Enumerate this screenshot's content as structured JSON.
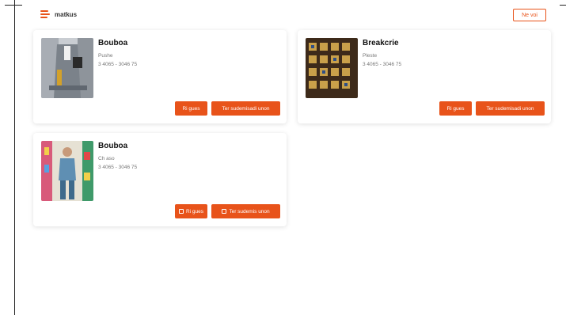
{
  "header": {
    "brand": "matkus",
    "top_button": "Ne voi"
  },
  "cards": [
    {
      "title": "Bouboa",
      "meta_1": "Pushe",
      "meta_2": "3 4065 - 3046 75",
      "primary_label": "Ri gues",
      "secondary_label": "Ter sudemisadi unon"
    },
    {
      "title": "Breakcrie",
      "meta_1": "Pleste",
      "meta_2": "3 4065 - 3046 75",
      "primary_label": "Ri gues",
      "secondary_label": "Ter sudemisadi unon"
    },
    {
      "title": "Bouboa",
      "meta_1": "Ch aso",
      "meta_2": "3 4065 - 3046 75",
      "primary_label": "Ri gues",
      "secondary_label": "Ter sudemis unon"
    }
  ],
  "colors": {
    "accent": "#e8531a"
  }
}
